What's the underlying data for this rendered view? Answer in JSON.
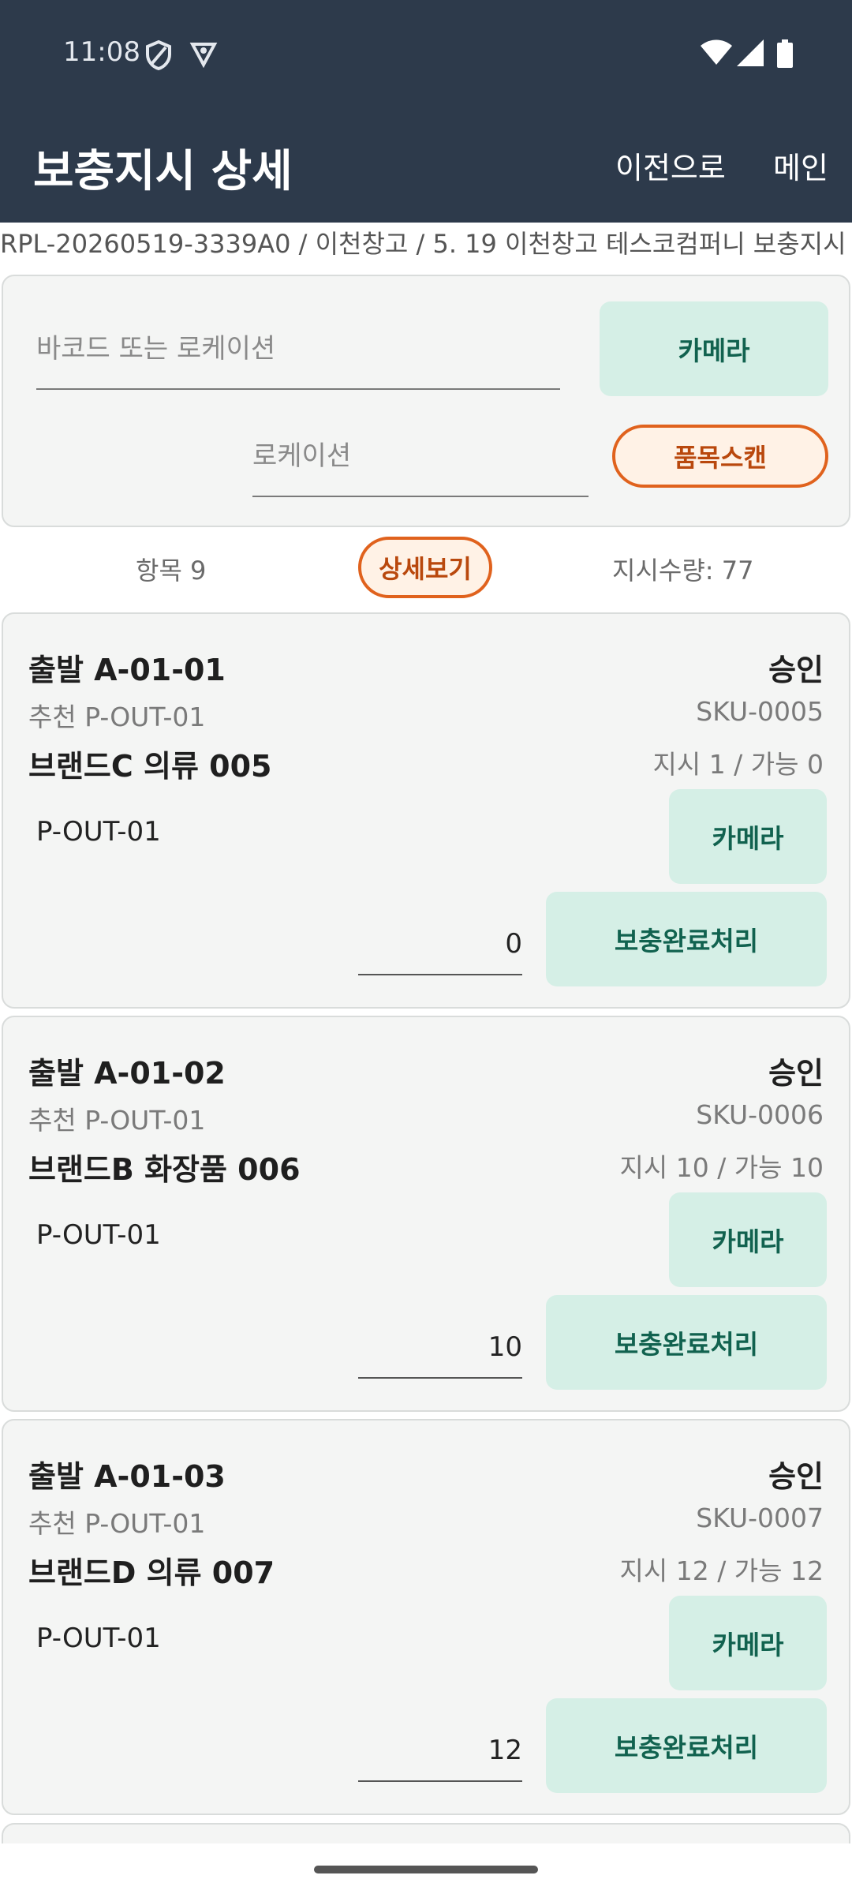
{
  "status_bar": {
    "time": "11:08"
  },
  "appbar": {
    "title": "보충지시 상세",
    "back": "이전으로",
    "main": "메인"
  },
  "subtitle": "RPL-20260519-3339A0 / 이천창고 / 5. 19 이천창고 테스코컴퍼니 보충지시",
  "scan": {
    "barcode_placeholder": "바코드 또는 로케이션",
    "camera": "카메라",
    "location_placeholder": "로케이션",
    "item_scan": "품목스캔"
  },
  "summary": {
    "items": "항목 9",
    "detail": "상세보기",
    "quantity": "지시수량: 77"
  },
  "cards": [
    {
      "from": "출발 A-01-01",
      "status": "승인",
      "recommend": "추천 P-OUT-01",
      "sku": "SKU-0005",
      "name": "브랜드C 의류 005",
      "qty": "지시 1 / 가능 0",
      "location": "P-OUT-01",
      "camera": "카메라",
      "input": "0",
      "done": "보충완료처리"
    },
    {
      "from": "출발 A-01-02",
      "status": "승인",
      "recommend": "추천 P-OUT-01",
      "sku": "SKU-0006",
      "name": "브랜드B 화장품 006",
      "qty": "지시 10 / 가능 10",
      "location": "P-OUT-01",
      "camera": "카메라",
      "input": "10",
      "done": "보충완료처리"
    },
    {
      "from": "출발 A-01-03",
      "status": "승인",
      "recommend": "추천 P-OUT-01",
      "sku": "SKU-0007",
      "name": "브랜드D 의류 007",
      "qty": "지시 12 / 가능 12",
      "location": "P-OUT-01",
      "camera": "카메라",
      "input": "12",
      "done": "보충완료처리"
    }
  ],
  "colors": {
    "header": "#2d3a4b",
    "mint": "#d5efe6",
    "mint_text": "#11624f",
    "orange": "#e0621d"
  }
}
